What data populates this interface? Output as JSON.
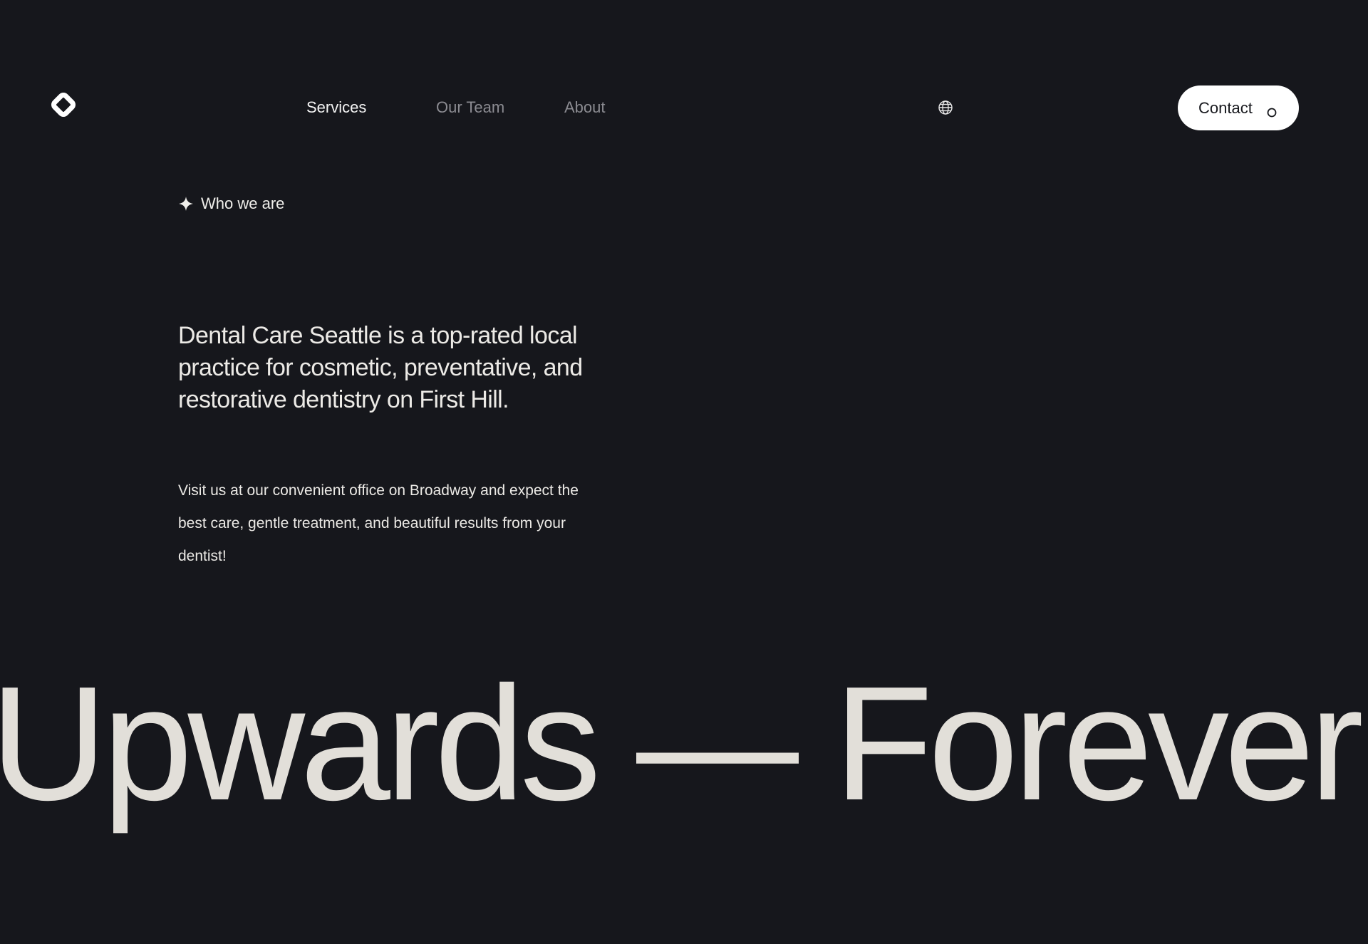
{
  "nav": {
    "logo_icon": "rounded-diamond-logo",
    "links": [
      {
        "label": "Services",
        "active": true
      },
      {
        "label": "Our Team",
        "active": false
      },
      {
        "label": "About",
        "active": false
      }
    ],
    "language_icon": "globe-icon",
    "contact_label": "Contact",
    "contact_icon": "circle-icon"
  },
  "intro": {
    "eyebrow_icon": "sparkle-icon",
    "eyebrow": "Who we are",
    "headline": "Dental Care Seattle is a top-rated local practice for cosmetic, preventative, and restorative dentistry on First Hill.",
    "body": "Visit us at our convenient office on Broadway and expect the best care, gentle treatment, and beautiful results from your dentist!"
  },
  "marquee": {
    "text": "Upwards — Forever U"
  },
  "colors": {
    "background": "#16171c",
    "text": "#f0efeb",
    "muted": "#8b8b91",
    "button_bg": "#ffffff",
    "button_text": "#16171c",
    "marquee": "#e2dfd9"
  }
}
